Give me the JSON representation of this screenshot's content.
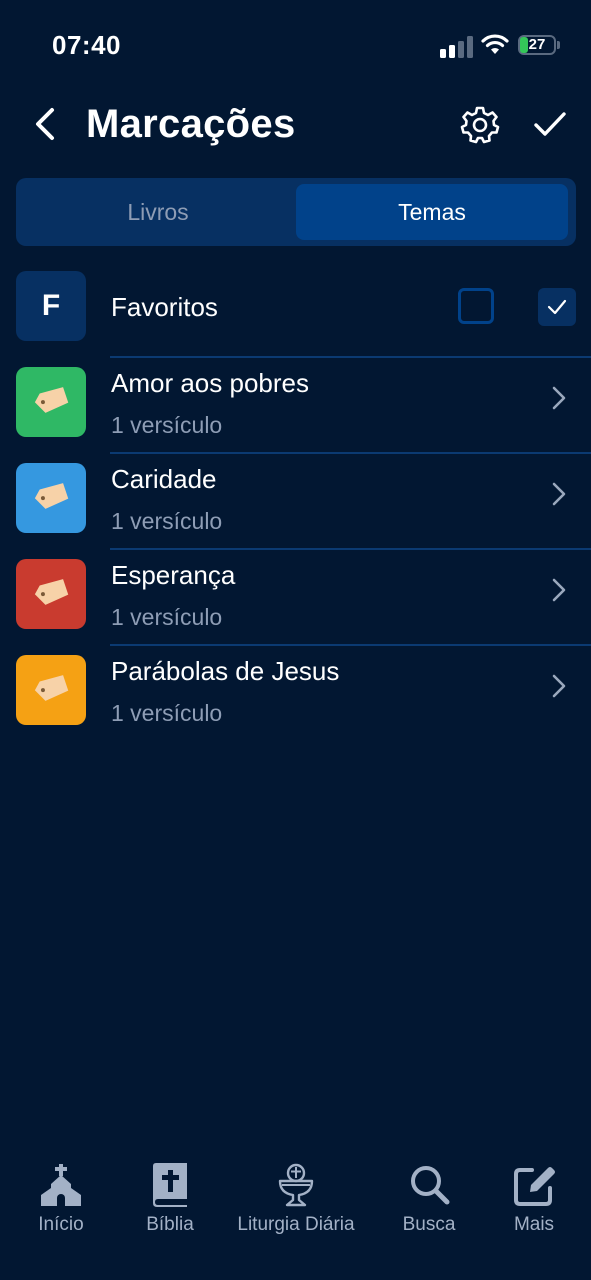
{
  "status_bar": {
    "time": "07:40",
    "battery": "27"
  },
  "header": {
    "title": "Marcações"
  },
  "tabs": {
    "livros": "Livros",
    "temas": "Temas",
    "active": "Temas"
  },
  "favorites": {
    "initial": "F",
    "label": "Favoritos",
    "checkbox_a_checked": false,
    "checkbox_b_checked": true
  },
  "themes": [
    {
      "name": "Amor aos pobres",
      "count": "1 versículo",
      "color": "#2fb865"
    },
    {
      "name": "Caridade",
      "count": "1 versículo",
      "color": "#3598e0"
    },
    {
      "name": "Esperança",
      "count": "1 versículo",
      "color": "#c93b2f"
    },
    {
      "name": "Parábolas de Jesus",
      "count": "1 versículo",
      "color": "#f5a114"
    }
  ],
  "tab_bar": {
    "items": [
      {
        "label": "Início",
        "icon": "church-icon"
      },
      {
        "label": "Bíblia",
        "icon": "bible-icon"
      },
      {
        "label": "Liturgia Diária",
        "icon": "chalice-icon"
      },
      {
        "label": "Busca",
        "icon": "search-icon"
      },
      {
        "label": "Mais",
        "icon": "edit-icon"
      }
    ]
  },
  "colors": {
    "background": "#021732",
    "accent": "#01428a",
    "muted_text": "#8e9db5",
    "tag_icon": "#f7d2a8"
  }
}
